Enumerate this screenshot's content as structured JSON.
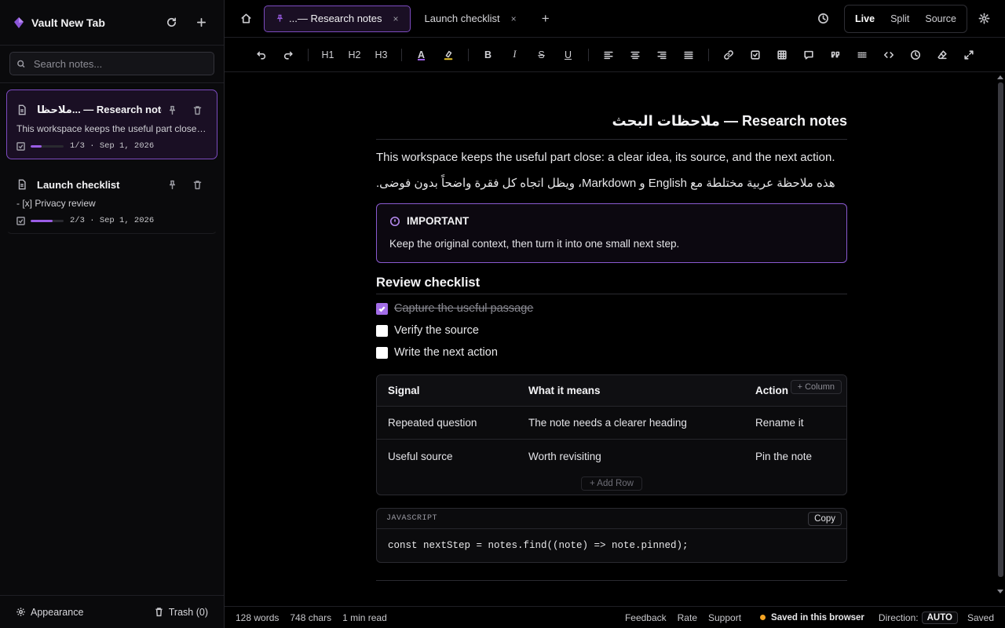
{
  "sidebar": {
    "app_title": "Vault New Tab",
    "search_placeholder": "Search notes...",
    "notes": [
      {
        "title": "ملاحظا... — Research notes",
        "excerpt": "This workspace keeps the useful part close: a c...",
        "progress_text": "1/3",
        "progress": 0.333,
        "date": "Sep 1, 2026"
      },
      {
        "title": "Launch checklist",
        "excerpt": "- [x] Privacy review",
        "progress_text": "2/3",
        "progress": 0.667,
        "date": "Sep 1, 2026"
      }
    ],
    "footer": {
      "appearance": "Appearance",
      "trash": "Trash (0)"
    }
  },
  "tabs": [
    {
      "label": "...— Research notes",
      "close": "×"
    },
    {
      "label": "Launch checklist",
      "close": "×"
    }
  ],
  "tabs_add": "+",
  "view_modes": [
    "Live",
    "Split",
    "Source"
  ],
  "toolbar": {
    "h1": "H1",
    "h2": "H2",
    "h3": "H3",
    "bold": "B",
    "italic": "I",
    "strike": "S",
    "underline": "U",
    "text_color": "A"
  },
  "document": {
    "title": "ملاحظات البحث — Research notes",
    "paragraph_en": "This workspace keeps the useful part close: a clear idea, its source, and the next action.",
    "paragraph_ar": "هذه ملاحظة عربية مختلطة مع English و Markdown، ويظل اتجاه كل فقرة واضحاً بدون فوضى.",
    "callout": {
      "label": "IMPORTANT",
      "body": "Keep the original context, then turn it into one small next step."
    },
    "checklist_heading": "Review checklist",
    "checklist": [
      {
        "label": "Capture the useful passage",
        "checked": true
      },
      {
        "label": "Verify the source",
        "checked": false
      },
      {
        "label": "Write the next action",
        "checked": false
      }
    ],
    "table": {
      "headers": [
        "Signal",
        "What it means",
        "Action"
      ],
      "rows": [
        [
          "Repeated question",
          "The note needs a clearer heading",
          "Rename it"
        ],
        [
          "Useful source",
          "Worth revisiting",
          "Pin the note"
        ]
      ],
      "add_column": "+ Column",
      "add_row": "+ Add Row"
    },
    "code": {
      "language": "JAVASCRIPT",
      "copy": "Copy",
      "line": "const nextStep = notes.find((note) => note.pinned);"
    }
  },
  "status": {
    "words": "128 words",
    "chars": "748 chars",
    "read": "1 min read",
    "feedback": "Feedback",
    "rate": "Rate",
    "support": "Support",
    "saved_browser": "Saved in this browser",
    "direction_label": "Direction:",
    "direction_value": "AUTO",
    "saved": "Saved"
  },
  "colors": {
    "accent": "#9b5de5",
    "saved_dot": "#f5a524"
  }
}
